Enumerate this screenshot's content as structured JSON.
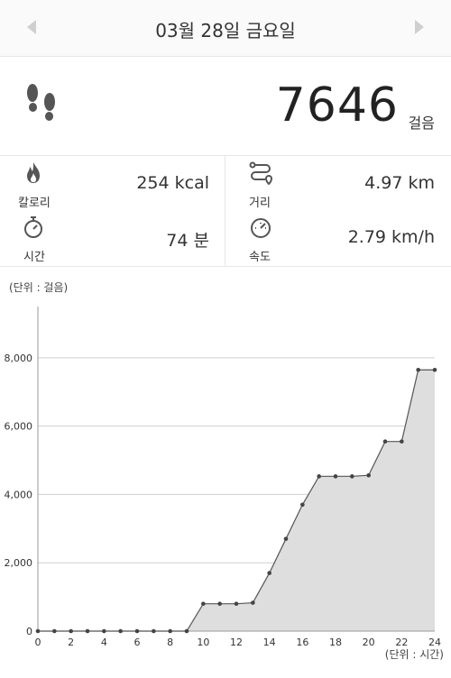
{
  "header": {
    "date_title": "03월 28일 금요일",
    "prev_icon": "chevron-left-icon",
    "next_icon": "chevron-right-icon"
  },
  "steps": {
    "icon": "footsteps-icon",
    "value": "7646",
    "unit": "걸음"
  },
  "stats": {
    "calories": {
      "icon": "flame-icon",
      "label": "칼로리",
      "value": "254 kcal"
    },
    "distance": {
      "icon": "route-icon",
      "label": "거리",
      "value": "4.97 km"
    },
    "time": {
      "icon": "stopwatch-icon",
      "label": "시간",
      "value": "74 분"
    },
    "speed": {
      "icon": "speedometer-icon",
      "label": "속도",
      "value": "2.79 km/h"
    }
  },
  "chart_unit_label": "(단위 : 걸음)",
  "chart_data": {
    "type": "area",
    "y_unit": "(단위 : 걸음)",
    "x_unit": "(단위 : 시간)",
    "xlim": [
      0,
      24
    ],
    "ylim": [
      0,
      9500
    ],
    "x_ticks": [
      0,
      2,
      4,
      6,
      8,
      10,
      12,
      14,
      16,
      18,
      20,
      22,
      24
    ],
    "y_ticks": [
      0,
      2000,
      4000,
      6000,
      8000
    ],
    "y_tick_labels": [
      "0",
      "2,000",
      "4,000",
      "6,000",
      "8,000"
    ],
    "grid": true,
    "fill_color": "#dedede",
    "line_color": "#555555",
    "x": [
      0,
      1,
      2,
      3,
      4,
      5,
      6,
      7,
      8,
      9,
      10,
      11,
      12,
      13,
      14,
      15,
      16,
      17,
      18,
      19,
      20,
      21,
      22,
      23,
      24
    ],
    "y": [
      0,
      0,
      0,
      0,
      0,
      0,
      0,
      0,
      0,
      0,
      800,
      800,
      800,
      830,
      1700,
      2700,
      3700,
      4530,
      4530,
      4530,
      4560,
      5550,
      5550,
      7646,
      7646
    ]
  }
}
